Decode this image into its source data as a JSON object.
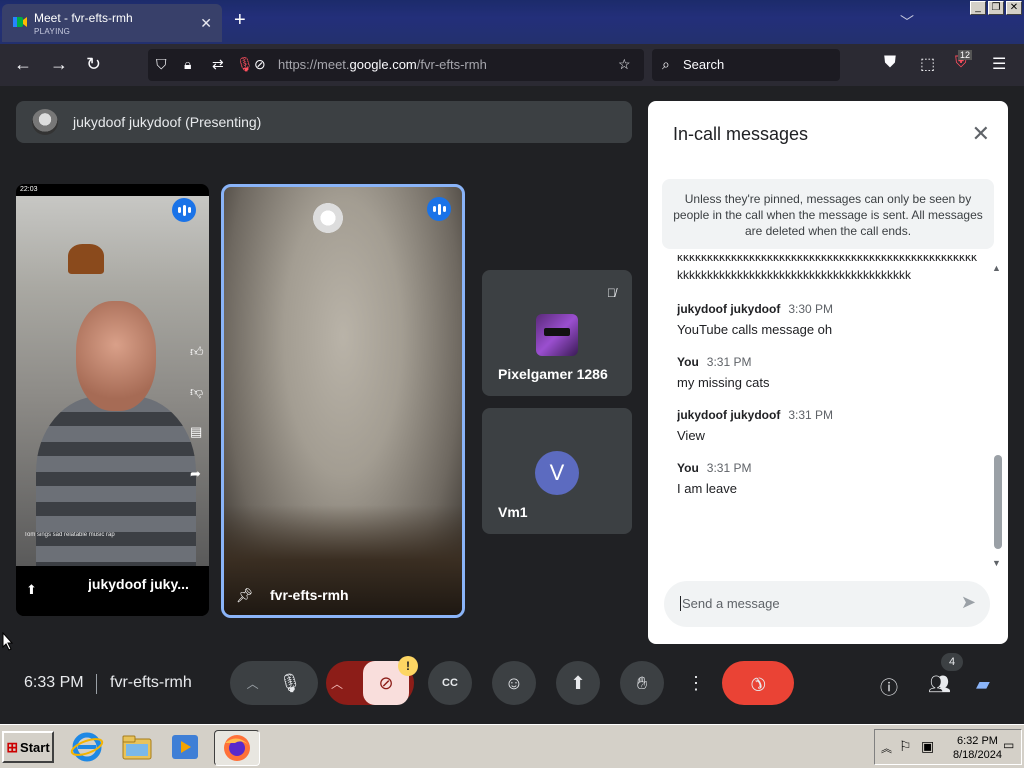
{
  "browser": {
    "tab_title": "Meet - fvr-efts-rmh",
    "tab_status": "PLAYING",
    "url_prefix": "https://meet.",
    "url_domain": "google.com",
    "url_path": "/fvr-efts-rmh",
    "search_label": "Search",
    "extension_badge": "12"
  },
  "meet": {
    "presenting_label": "jukydoof jukydoof (Presenting)",
    "tiles": {
      "phone_name": "jukydoof juky...",
      "phone_clock": "22:03",
      "phone_caption": "Tom sings sad relatable music rap",
      "cam_name": "fvr-efts-rmh",
      "pg_name": "Pixelgamer 1286",
      "vm_name": "Vm1",
      "vm_initial": "V"
    }
  },
  "chat": {
    "title": "In-call messages",
    "notice": "Unless they're pinned, messages can only be seen by people in the call when the message is sent. All messages are deleted when the call ends.",
    "partial_message": "kkkkkkkkkkkkkkkkkkkkkkkkkkkkkkkkkkkkkkkkkkkkkkkkkkkkkkkkkkkkkkkkkkkkkkkkkkkkkkkkkkkkkkkkk",
    "messages": [
      {
        "sender": "jukydoof jukydoof",
        "time": "3:30 PM",
        "text": "YouTube calls message oh"
      },
      {
        "sender": "You",
        "time": "3:31 PM",
        "text": "my missing cats"
      },
      {
        "sender": "jukydoof jukydoof",
        "time": "3:31 PM",
        "text": "View"
      },
      {
        "sender": "You",
        "time": "3:31 PM",
        "text": "I am leave"
      }
    ],
    "input_placeholder": "Send a message"
  },
  "bottombar": {
    "time": "6:33 PM",
    "meeting_code": "fvr-efts-rmh",
    "warning_badge": "!",
    "people_count": "4"
  },
  "taskbar": {
    "start_label": "Start",
    "time": "6:32 PM",
    "date": "8/18/2024"
  },
  "colors": {
    "accent_blue": "#1a73e8",
    "end_call_red": "#ea4335",
    "warning_yellow": "#fdd663"
  }
}
